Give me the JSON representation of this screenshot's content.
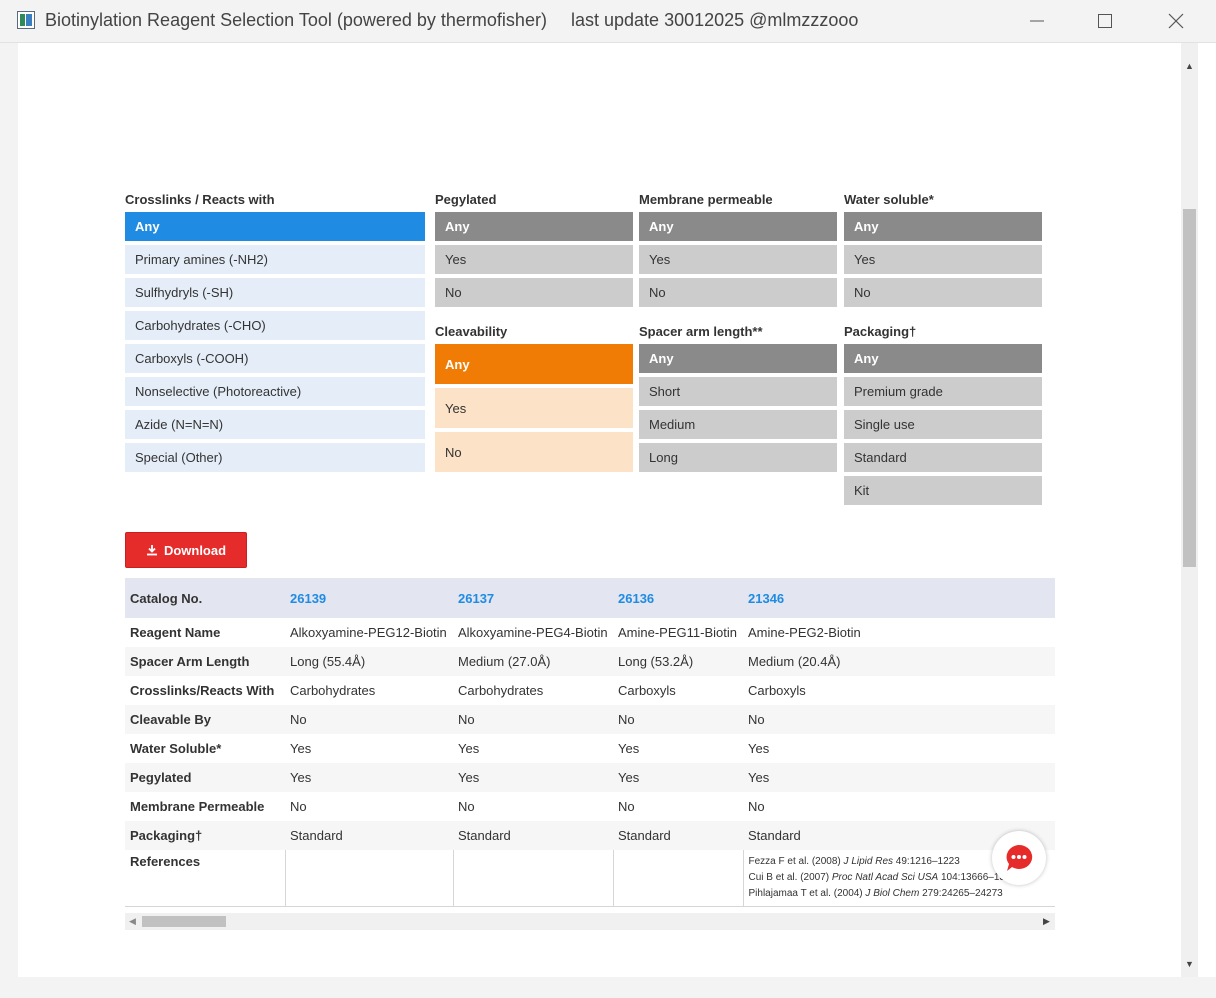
{
  "window": {
    "title": "Biotinylation Reagent Selection Tool (powered by thermofisher)",
    "update_note": "last update 30012025 @mlmzzzooo"
  },
  "filters": {
    "crosslinks": {
      "title": "Crosslinks / Reacts with",
      "options": [
        "Any",
        "Primary amines (-NH2)",
        "Sulfhydryls (-SH)",
        "Carbohydrates (-CHO)",
        "Carboxyls (-COOH)",
        "Nonselective (Photoreactive)",
        "Azide (N=N=N)",
        "Special (Other)"
      ],
      "selected": "Any"
    },
    "pegylated": {
      "title": "Pegylated",
      "options": [
        "Any",
        "Yes",
        "No"
      ],
      "selected": "Any"
    },
    "membrane": {
      "title": "Membrane permeable",
      "options": [
        "Any",
        "Yes",
        "No"
      ],
      "selected": "Any"
    },
    "water": {
      "title": "Water soluble*",
      "options": [
        "Any",
        "Yes",
        "No"
      ],
      "selected": "Any"
    },
    "cleavability": {
      "title": "Cleavability",
      "options": [
        "Any",
        "Yes",
        "No"
      ],
      "selected": "Any"
    },
    "spacer": {
      "title": "Spacer arm length**",
      "options": [
        "Any",
        "Short",
        "Medium",
        "Long"
      ],
      "selected": "Any"
    },
    "packaging": {
      "title": "Packaging†",
      "options": [
        "Any",
        "Premium grade",
        "Single use",
        "Standard",
        "Kit"
      ],
      "selected": "Any"
    }
  },
  "download": {
    "label": "Download"
  },
  "table": {
    "header_label": "Catalog No.",
    "catalog_nos": [
      "26139",
      "26137",
      "26136",
      "21346"
    ],
    "rows": [
      {
        "label": "Reagent Name",
        "values": [
          "Alkoxyamine-PEG12-Biotin",
          "Alkoxyamine-PEG4-Biotin",
          "Amine-PEG11-Biotin",
          "Amine-PEG2-Biotin"
        ]
      },
      {
        "label": "Spacer Arm Length",
        "values": [
          "Long (55.4Å)",
          "Medium (27.0Å)",
          "Long (53.2Å)",
          "Medium (20.4Å)"
        ]
      },
      {
        "label": "Crosslinks/Reacts With",
        "values": [
          "Carbohydrates",
          "Carbohydrates",
          "Carboxyls",
          "Carboxyls"
        ]
      },
      {
        "label": "Cleavable By",
        "values": [
          "No",
          "No",
          "No",
          "No"
        ]
      },
      {
        "label": "Water Soluble*",
        "values": [
          "Yes",
          "Yes",
          "Yes",
          "Yes"
        ]
      },
      {
        "label": "Pegylated",
        "values": [
          "Yes",
          "Yes",
          "Yes",
          "Yes"
        ]
      },
      {
        "label": "Membrane Permeable",
        "values": [
          "No",
          "No",
          "No",
          "No"
        ]
      },
      {
        "label": "Packaging†",
        "values": [
          "Standard",
          "Standard",
          "Standard",
          "Standard"
        ]
      }
    ],
    "references_label": "References",
    "references": [
      {
        "pre": "Fezza F et al. (2008) ",
        "journal": "J Lipid Res",
        "post": " 49:1216–1223"
      },
      {
        "pre": "Cui B et al. (2007) ",
        "journal": "Proc Natl Acad Sci USA",
        "post": " 104:13666–13671"
      },
      {
        "pre": "Pihlajamaa T et al. (2004) ",
        "journal": "J Biol Chem",
        "post": " 279:24265–24273"
      }
    ]
  },
  "colors": {
    "selected_blue": "#1f8be2",
    "selected_gray": "#8a8a8a",
    "selected_orange": "#f07b05",
    "download_red": "#e62b2b",
    "chat_red": "#e62b2b"
  },
  "icons": {
    "window_icon": "app-window-icon",
    "minimize": "minimize-icon",
    "maximize": "maximize-icon",
    "close": "close-icon",
    "download": "download-icon",
    "chat": "chat-icon"
  }
}
